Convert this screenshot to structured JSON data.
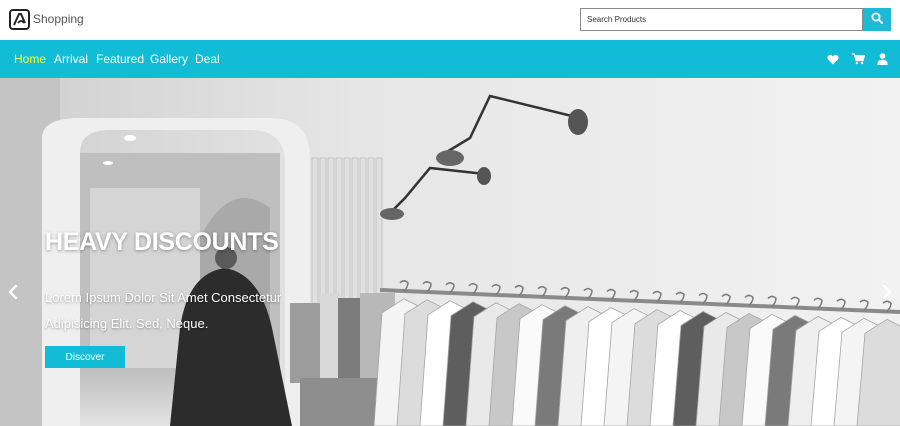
{
  "header": {
    "brand": "Shopping",
    "search_placeholder": "Search Products",
    "search_icon": "search-icon",
    "logo_icon": "logo-icon"
  },
  "nav": {
    "items": [
      {
        "label": "Home",
        "active": true
      },
      {
        "label": "Arrival",
        "active": false
      },
      {
        "label": "Featured",
        "active": false
      },
      {
        "label": "Gallery",
        "active": false
      },
      {
        "label": "Deal",
        "active": false
      }
    ],
    "icons": [
      "heart-icon",
      "cart-icon",
      "user-icon"
    ]
  },
  "hero": {
    "title": "HEAVY DISCOUNTS",
    "text": "Lorem Ipsum Dolor Sit Amet Consectetur Adipisicing Elit. Sed, Neque.",
    "button_label": "Discover",
    "prev_icon": "chevron-left-icon",
    "next_icon": "chevron-right-icon"
  },
  "colors": {
    "accent": "#13bcd6",
    "active_nav": "#f4ff3a",
    "text_white": "#ffffff"
  }
}
